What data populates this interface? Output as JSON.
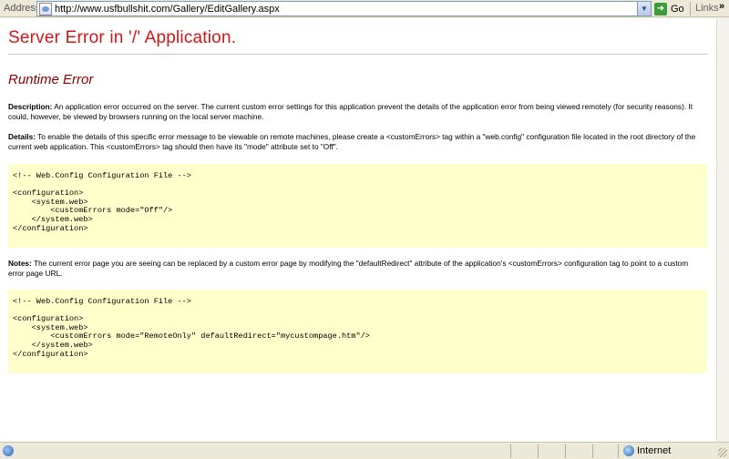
{
  "browser": {
    "address_label": "Address",
    "url": "http://www.usfbullshit.com/Gallery/EditGallery.aspx",
    "go_label": "Go",
    "links_label": "Links",
    "chevron": "»"
  },
  "page": {
    "title": "Server Error in '/' Application.",
    "subtitle": "Runtime Error",
    "description_label": "Description:",
    "description_text": " An application error occurred on the server. The current custom error settings for this application prevent the details of the application error from being viewed remotely (for security reasons). It could, however, be viewed by browsers running on the local server machine.",
    "details_label": "Details:",
    "details_text": " To enable the details of this specific error message to be viewable on remote machines, please create a <customErrors> tag within a \"web.config\" configuration file located in the root directory of the current web application. This <customErrors> tag should then have its \"mode\" attribute set to \"Off\".",
    "code1": "<!-- Web.Config Configuration File -->\n\n<configuration>\n    <system.web>\n        <customErrors mode=\"Off\"/>\n    </system.web>\n</configuration>",
    "notes_label": "Notes:",
    "notes_text": " The current error page you are seeing can be replaced by a custom error page by modifying the \"defaultRedirect\" attribute of the application's <customErrors> configuration tag to point to a custom error page URL.",
    "code2": "<!-- Web.Config Configuration File -->\n\n<configuration>\n    <system.web>\n        <customErrors mode=\"RemoteOnly\" defaultRedirect=\"mycustompage.htm\"/>\n    </system.web>\n</configuration>"
  },
  "status": {
    "zone": "Internet"
  },
  "colors": {
    "title_red": "#d11818",
    "subtitle_maroon": "#8b0000",
    "code_background": "#ffffcc"
  }
}
